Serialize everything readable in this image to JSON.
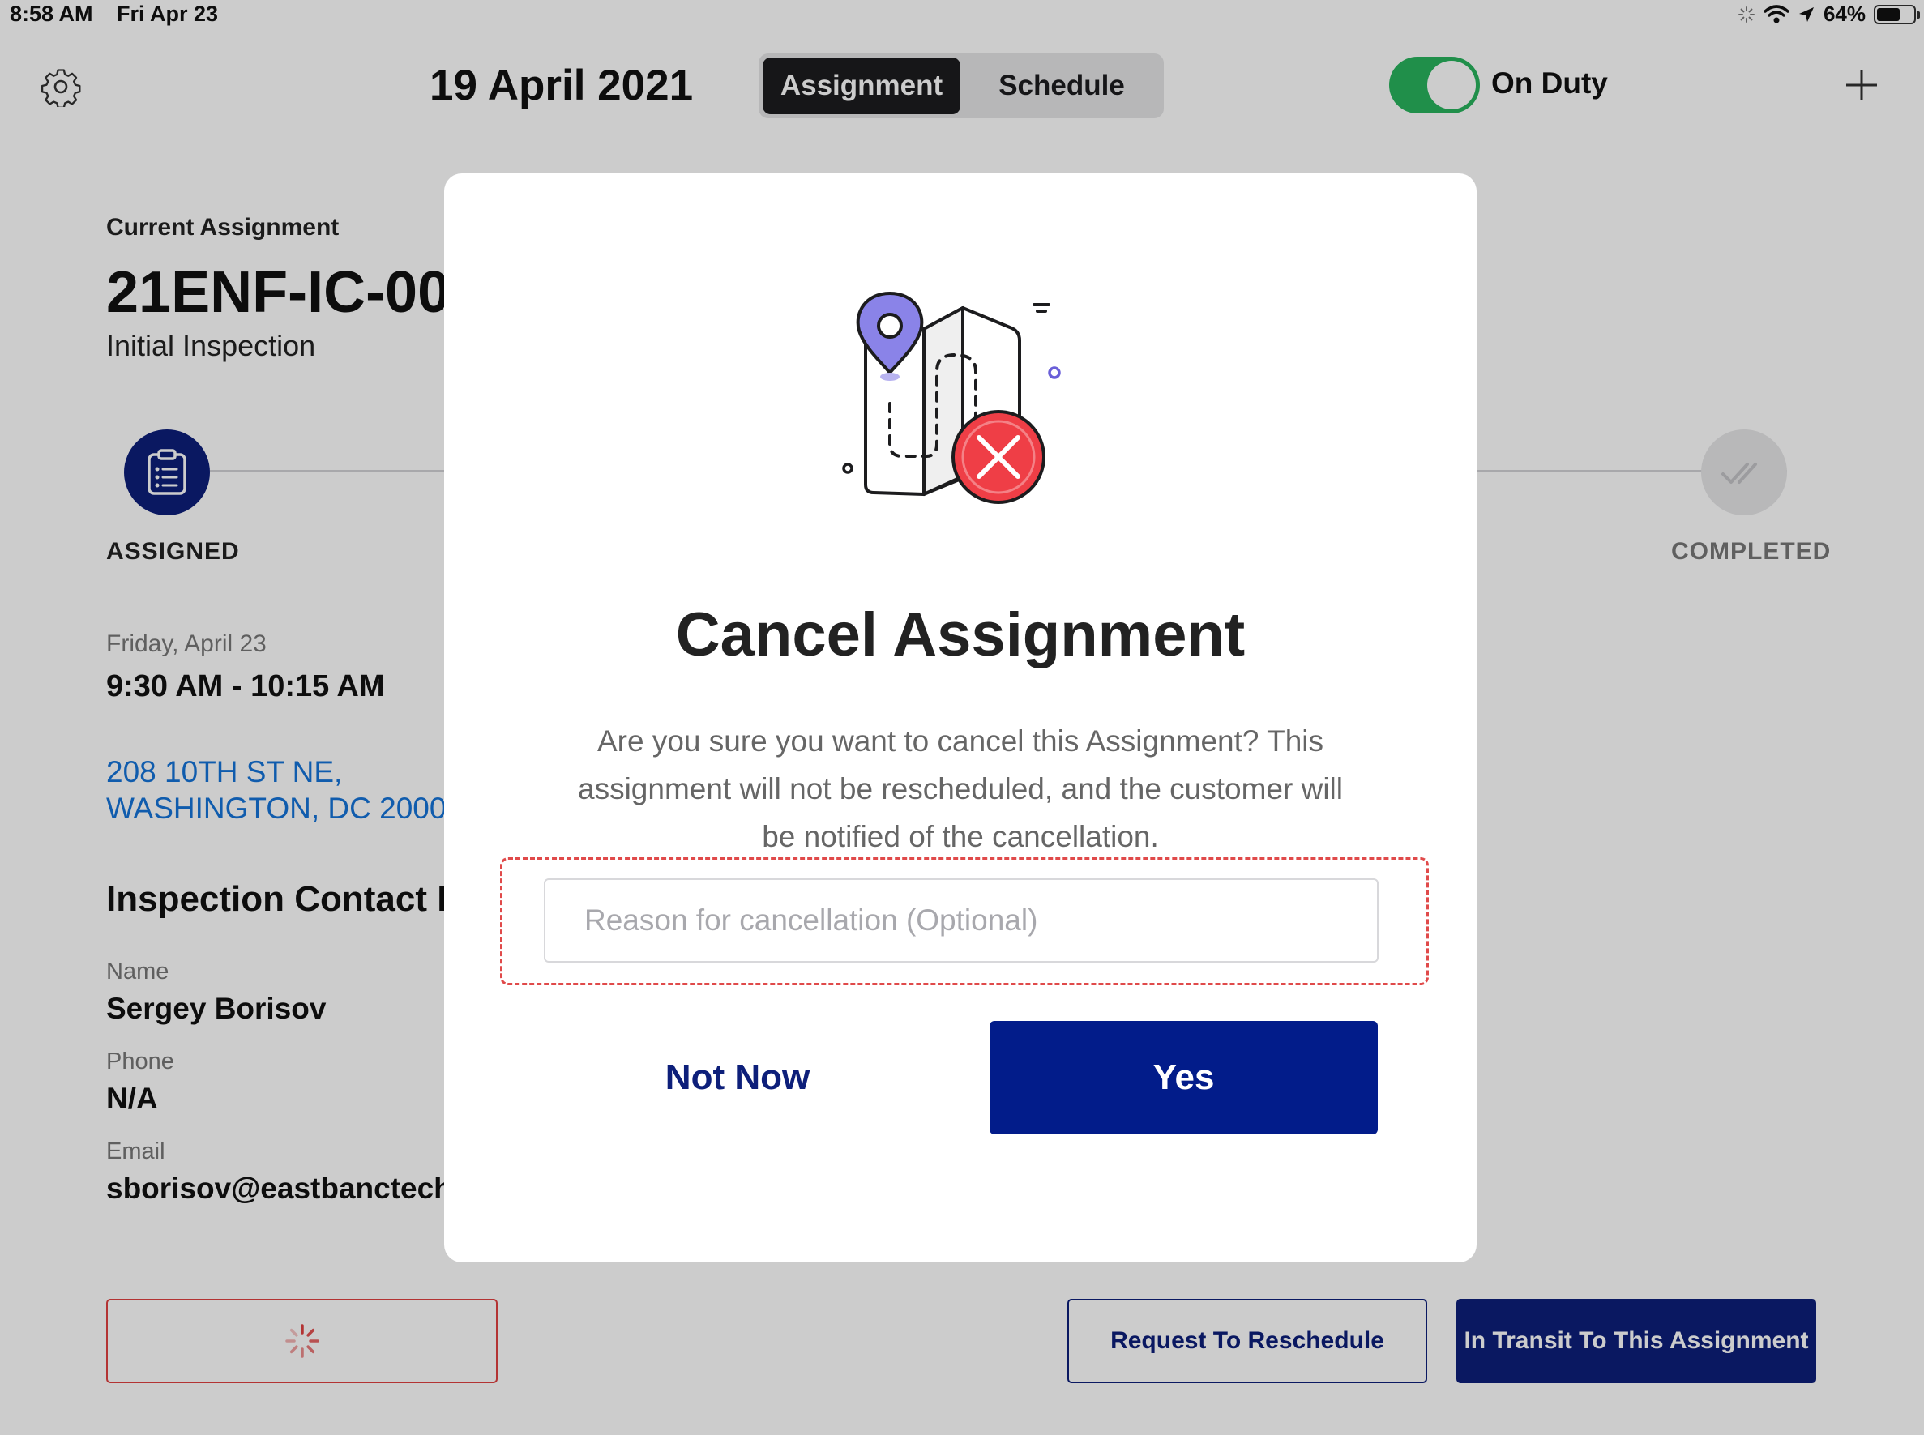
{
  "status_bar": {
    "time": "8:58 AM",
    "date": "Fri Apr 23",
    "battery": "64%",
    "battery_level": 0.64
  },
  "header": {
    "date_title": "19 April 2021",
    "tabs": [
      {
        "label": "Assignment",
        "active": true
      },
      {
        "label": "Schedule",
        "active": false
      }
    ],
    "duty_label": "On Duty",
    "duty_on": true
  },
  "assignment": {
    "section_label": "Current Assignment",
    "id": "21ENF-IC-00",
    "type": "Initial Inspection",
    "steps": [
      {
        "label": "ASSIGNED",
        "state": "active"
      },
      {
        "label": "COMPLETED",
        "state": "inactive"
      }
    ],
    "day": "Friday, April 23",
    "time_range": "9:30 AM - 10:15 AM",
    "address_line1": "208 10TH ST NE,",
    "address_line2": "WASHINGTON, DC 2000"
  },
  "contact": {
    "heading": "Inspection Contact I",
    "name_label": "Name",
    "name": "Sergey Borisov",
    "phone_label": "Phone",
    "phone": "N/A",
    "email_label": "Email",
    "email": "sborisov@eastbanctech"
  },
  "footer": {
    "reschedule_label": "Request To Reschedule",
    "transit_label": "In Transit To This Assignment"
  },
  "modal": {
    "title": "Cancel Assignment",
    "message": "Are you sure you want to cancel this Assignment? This assignment will not be rescheduled, and the customer will be notified of the cancellation.",
    "reason_placeholder": "Reason for cancellation (Optional)",
    "reason_value": "",
    "not_now_label": "Not Now",
    "yes_label": "Yes"
  },
  "colors": {
    "brand_navy": "#0d1f7a",
    "toggle_green": "#28b35d",
    "danger_red": "#e04040",
    "link_blue": "#1473d9"
  }
}
